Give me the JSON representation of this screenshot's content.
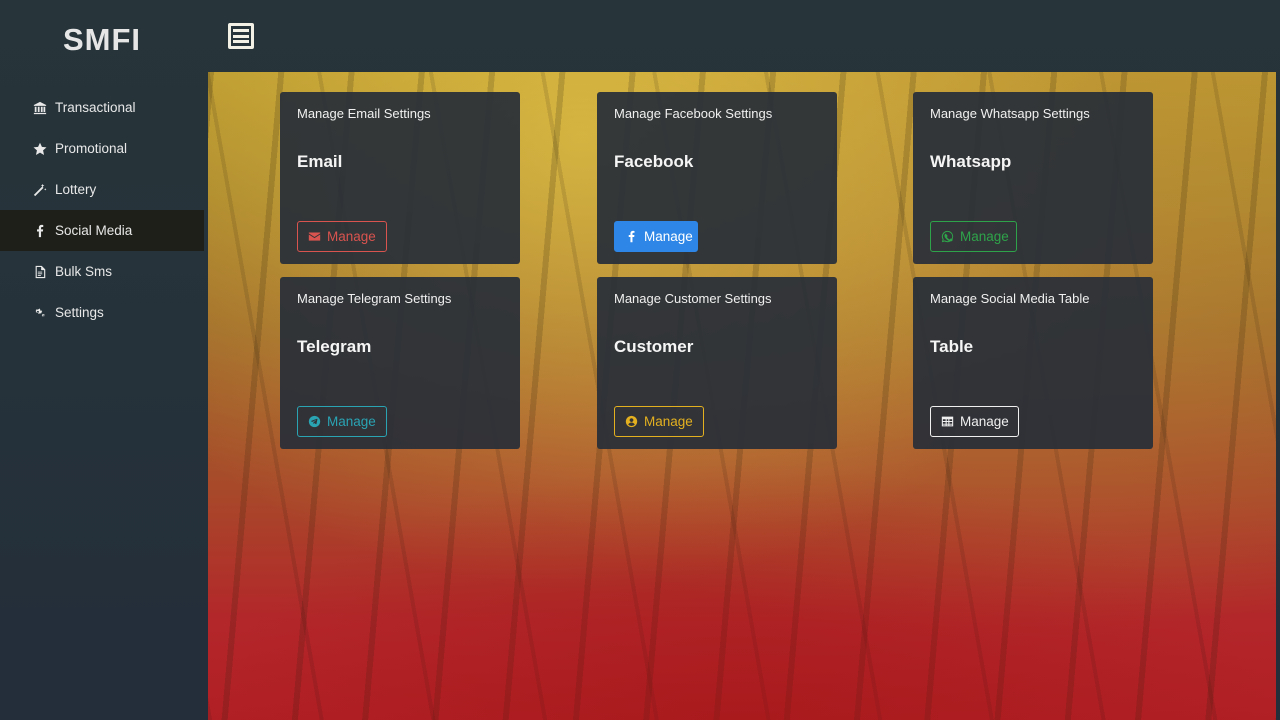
{
  "brand": "SMFI",
  "sidebar": {
    "items": [
      {
        "label": "Transactional",
        "icon": "bank-icon"
      },
      {
        "label": "Promotional",
        "icon": "star-icon"
      },
      {
        "label": "Lottery",
        "icon": "magic-wand-icon"
      },
      {
        "label": "Social Media",
        "icon": "facebook-icon",
        "active": true
      },
      {
        "label": "Bulk Sms",
        "icon": "file-icon"
      },
      {
        "label": "Settings",
        "icon": "gears-icon"
      }
    ]
  },
  "cards": [
    {
      "subtitle": "Manage Email Settings",
      "title": "Email",
      "button": "Manage",
      "icon": "envelope-icon",
      "color": "#d9534f"
    },
    {
      "subtitle": "Manage Facebook Settings",
      "title": "Facebook",
      "button": "Manage",
      "icon": "facebook-icon",
      "color": "#2e87e6"
    },
    {
      "subtitle": "Manage Whatsapp Settings",
      "title": "Whatsapp",
      "button": "Manage",
      "icon": "whatsapp-icon",
      "color": "#2ea34a"
    },
    {
      "subtitle": "Manage Telegram Settings",
      "title": "Telegram",
      "button": "Manage",
      "icon": "telegram-icon",
      "color": "#2aa3b3"
    },
    {
      "subtitle": "Manage Customer Settings",
      "title": "Customer",
      "button": "Manage",
      "icon": "user-circle-icon",
      "color": "#e3b020"
    },
    {
      "subtitle": "Manage Social Media Table",
      "title": "Table",
      "button": "Manage",
      "icon": "table-icon",
      "color": "#f0f0f0"
    }
  ]
}
